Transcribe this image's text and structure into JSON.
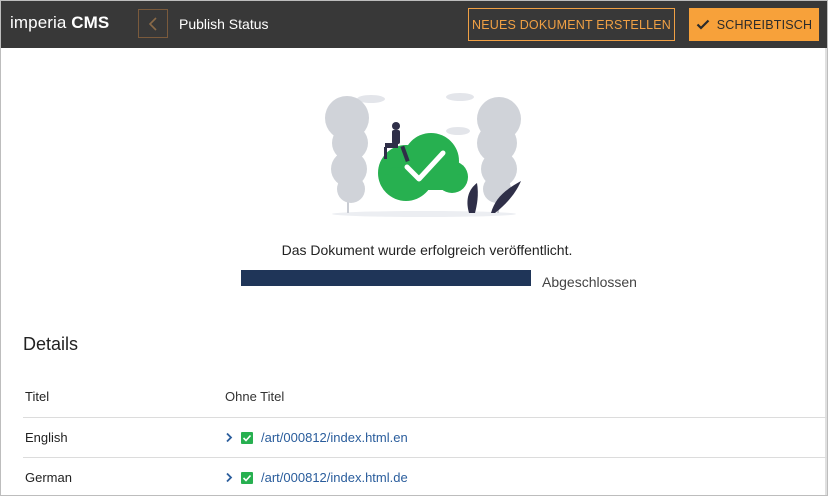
{
  "app": {
    "logo_light": "imperia",
    "logo_bold": "CMS",
    "page_title": "Publish Status"
  },
  "toolbar": {
    "new_document_label": "NEUES DOKUMENT ERSTELLEN",
    "desk_label": "SCHREIBTISCH"
  },
  "status": {
    "message": "Das Dokument wurde erfolgreich veröffentlicht.",
    "progress_value": 1.0,
    "progress_label": "Abgeschlossen"
  },
  "details": {
    "title": "Details",
    "rows": [
      {
        "label": "Titel",
        "value": "Ohne Titel"
      },
      {
        "label": "English",
        "value": "/art/000812/index.html.en"
      },
      {
        "label": "German",
        "value": "/art/000812/index.html.de"
      }
    ]
  },
  "colors": {
    "topbar": "#383838",
    "accent": "#f7a13a",
    "progress": "#1f3558",
    "success": "#27b050",
    "link": "#2a5d9c"
  },
  "icons": [
    "chevron-left-icon",
    "checkmark-icon",
    "chevron-right-icon",
    "checkbox-checked-icon",
    "success-cloud-illustration"
  ]
}
